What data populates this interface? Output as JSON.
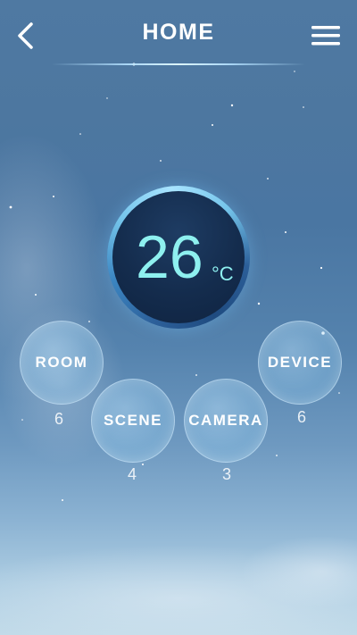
{
  "header": {
    "title": "HOME"
  },
  "temperature": {
    "value": "26",
    "unit": "°C"
  },
  "categories": [
    {
      "label": "ROOM",
      "count": "6"
    },
    {
      "label": "SCENE",
      "count": "4"
    },
    {
      "label": "CAMERA",
      "count": "3"
    },
    {
      "label": "DEVICE",
      "count": "6"
    }
  ],
  "icons": {
    "back": "chevron-left-icon",
    "menu": "hamburger-menu-icon"
  },
  "colors": {
    "temperature_text": "#8ef0ef",
    "ring_accent": "#74c4ea"
  }
}
